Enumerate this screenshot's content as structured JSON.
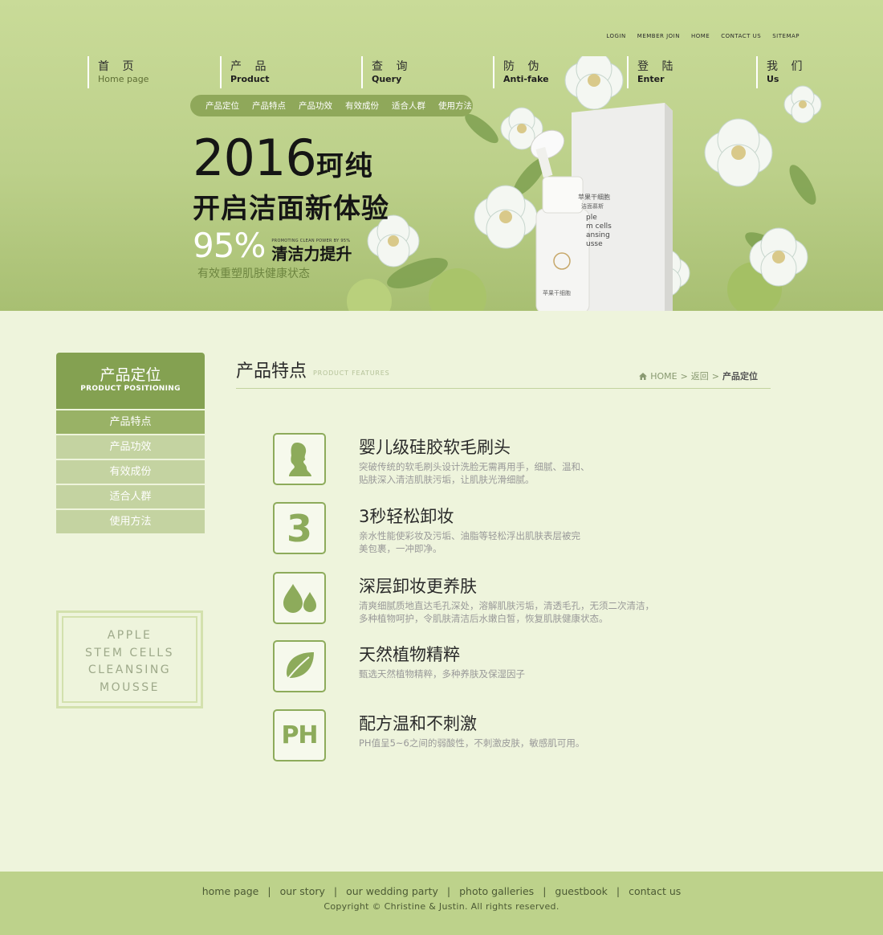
{
  "top_links": [
    "LOGIN",
    "MEMBER JOIN",
    "HOME",
    "CONTACT US",
    "SITEMAP"
  ],
  "nav": [
    {
      "cn": "首 页",
      "en": "Home page"
    },
    {
      "cn": "产 品",
      "en": "Product"
    },
    {
      "cn": "查 询",
      "en": "Query"
    },
    {
      "cn": "防 伪",
      "en": "Anti-fake"
    },
    {
      "cn": "登 陆",
      "en": "Enter"
    },
    {
      "cn": "我 们",
      "en": "Us"
    }
  ],
  "subnav": [
    "产品定位",
    "产品特点",
    "产品功效",
    "有效成份",
    "适合人群",
    "使用方法"
  ],
  "banner": {
    "year": "2016",
    "brand": "珂纯",
    "line2": "开启洁面新体验",
    "percent": "95%",
    "promo_en": "PROMOTING CLEAN POWER BY 95%",
    "promo_cn": "清洁力提升",
    "tagline": "有效重塑肌肤健康状态",
    "bottle_text": "苹果干细胞",
    "box_text": [
      "苹果干细胞",
      "洁面慕斯",
      "ple",
      "m cells",
      "ansing",
      "usse"
    ]
  },
  "sidebar": {
    "title_cn": "产品定位",
    "title_en": "PRODUCT POSITIONING",
    "items": [
      "产品特点",
      "产品功效",
      "有效成份",
      "适合人群",
      "使用方法"
    ],
    "active_index": 0,
    "box_lines": [
      "APPLE",
      "STEM CELLS",
      "CLEANSING",
      "MOUSSE"
    ]
  },
  "content": {
    "title": "产品特点",
    "subtitle": "PRODUCT FEATURES",
    "breadcrumb": {
      "home": "HOME",
      "sep": ">",
      "back": "返回",
      "current": "产品定位"
    }
  },
  "features": [
    {
      "icon": "silhouette-icon",
      "title": "婴儿级硅胶软毛刷头",
      "desc": [
        "突破传统的软毛刷头设计洗脸无需再用手，细腻、温和、",
        "贴肤深入清洁肌肤污垢，让肌肤光滑细腻。"
      ]
    },
    {
      "icon": "number-3-icon",
      "glyph": "3",
      "title": "3秒轻松卸妆",
      "desc": [
        "亲水性能使彩妆及污垢、油脂等轻松浮出肌肤表层被完",
        "美包裹，一冲即净。"
      ]
    },
    {
      "icon": "water-drops-icon",
      "title": "深层卸妆更养肤",
      "desc": [
        "清爽细腻质地直达毛孔深处，溶解肌肤污垢，清透毛孔，无须二次清洁，",
        "多种植物呵护，令肌肤清洁后水嫩白皙，恢复肌肤健康状态。"
      ]
    },
    {
      "icon": "leaf-icon",
      "title": "天然植物精粹",
      "desc": [
        "甄选天然植物精粹，多种养肤及保湿因子"
      ]
    },
    {
      "icon": "ph-icon",
      "glyph": "PH",
      "title": "配方温和不刺激",
      "desc": [
        "PH值呈5~6之间的弱酸性，不刺激皮肤，敏感肌可用。"
      ]
    }
  ],
  "footer": {
    "links": [
      "home page",
      "our story",
      "our wedding party",
      "photo galleries",
      "guestbook",
      "contact us"
    ],
    "separator": "|",
    "copyright": "Copyright © Christine & Justin. All rights reserved."
  },
  "colors": {
    "accent": "#84a151",
    "banner": "#c9db98",
    "page_bg": "#eef4dc",
    "footer": "#bdd28b"
  }
}
